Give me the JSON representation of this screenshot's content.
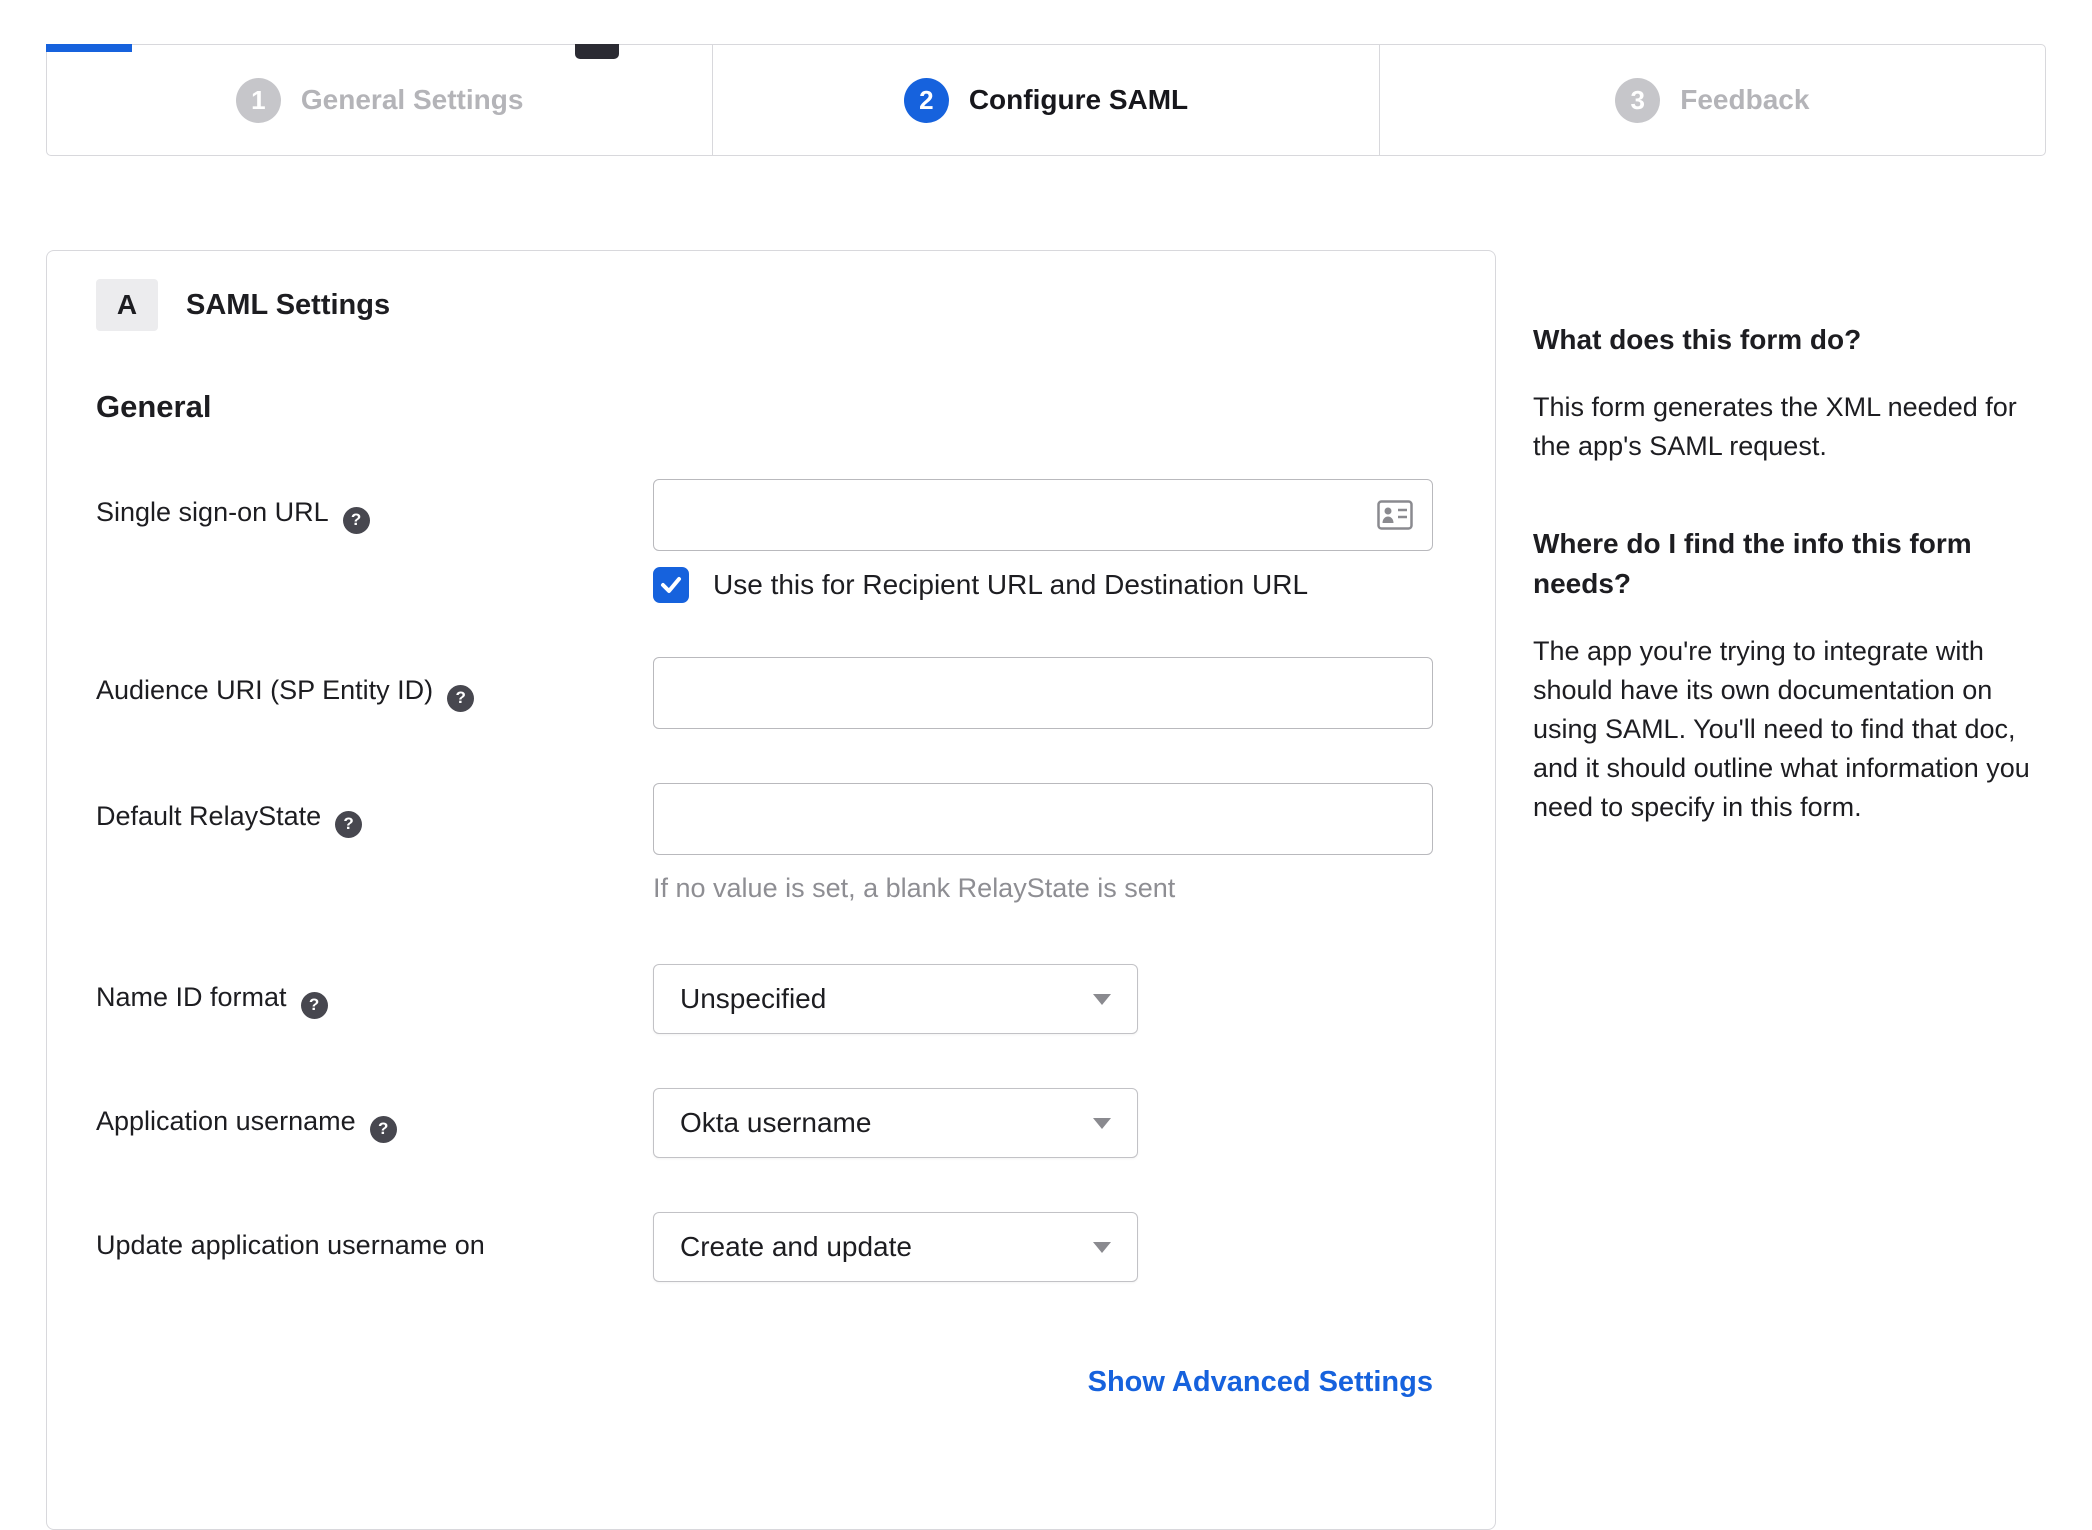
{
  "stepper": {
    "steps": [
      {
        "number": "1",
        "label": "General Settings",
        "state": "inactive"
      },
      {
        "number": "2",
        "label": "Configure SAML",
        "state": "active"
      },
      {
        "number": "3",
        "label": "Feedback",
        "state": "inactive"
      }
    ]
  },
  "panel": {
    "section_badge": "A",
    "section_title": "SAML Settings",
    "group_title": "General",
    "fields": {
      "sso_url": {
        "label": "Single sign-on URL",
        "value": ""
      },
      "sso_checkbox": {
        "label": "Use this for Recipient URL and Destination URL",
        "checked": true
      },
      "audience_uri": {
        "label": "Audience URI (SP Entity ID)",
        "value": ""
      },
      "relay_state": {
        "label": "Default RelayState",
        "value": "",
        "hint": "If no value is set, a blank RelayState is sent"
      },
      "name_id_format": {
        "label": "Name ID format",
        "value": "Unspecified"
      },
      "app_username": {
        "label": "Application username",
        "value": "Okta username"
      },
      "update_app_username": {
        "label": "Update application username on",
        "value": "Create and update"
      }
    },
    "help_glyph": "?",
    "advanced_link": "Show Advanced Settings"
  },
  "sidebar": {
    "q1_title": "What does this form do?",
    "q1_body": "This form generates the XML needed for the app's SAML request.",
    "q2_title": "Where do I find the info this form needs?",
    "q2_body": "The app you're trying to integrate with should have its own documentation on using SAML. You'll need to find that doc, and it should outline what information you need to specify in this form."
  },
  "colors": {
    "accent_blue": "#1662dd",
    "inactive_gray": "#b4b4b8",
    "text_dark": "#1d1d21",
    "border_gray": "#d8d8dc"
  }
}
